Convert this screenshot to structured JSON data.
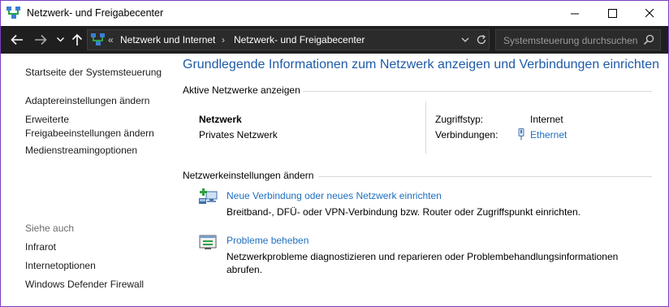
{
  "window": {
    "title": "Netzwerk- und Freigabecenter",
    "controls": {
      "minimize": "—",
      "maximize": "☐",
      "close": "✕"
    }
  },
  "navigation": {
    "back_icon": "arrow-left-icon",
    "forward_icon": "arrow-right-icon",
    "recent_icon": "chevron-down-icon",
    "up_icon": "arrow-up-icon",
    "breadcrumb_prefix": "«",
    "breadcrumbs": [
      "Netzwerk und Internet",
      "Netzwerk- und Freigabecenter"
    ],
    "breadcrumb_separator": "›",
    "search_placeholder": "Systemsteuerung durchsuchen"
  },
  "sidebar": {
    "home_link": "Startseite der Systemsteuerung",
    "links": [
      "Adaptereinstellungen ändern",
      "Erweiterte Freigabeeinstellungen ändern",
      "Medienstreamingoptionen"
    ],
    "see_also_heading": "Siehe auch",
    "see_also": [
      "Infrarot",
      "Internetoptionen",
      "Windows Defender Firewall"
    ]
  },
  "main": {
    "title": "Grundlegende Informationen zum Netzwerk anzeigen und Verbindungen einrichten",
    "active_networks": {
      "heading": "Aktive Netzwerke anzeigen",
      "network_name": "Netzwerk",
      "network_type": "Privates Netzwerk",
      "access_type_label": "Zugriffstyp:",
      "access_type_value": "Internet",
      "connections_label": "Verbindungen:",
      "connection_value": "Ethernet"
    },
    "settings": {
      "heading": "Netzwerkeinstellungen ändern",
      "tasks": [
        {
          "link": "Neue Verbindung oder neues Netzwerk einrichten",
          "description": "Breitband-, DFÜ- oder VPN-Verbindung bzw. Router oder Zugriffspunkt einrichten."
        },
        {
          "link": "Probleme beheben",
          "description": "Netzwerkprobleme diagnostizieren und reparieren oder Problembehandlungsinformationen abrufen."
        }
      ]
    }
  },
  "colors": {
    "accent_border": "#7a3fc0",
    "link_blue": "#1e6fc0",
    "title_blue": "#1e5aa8",
    "addressbar_bg": "#1f1f1f"
  }
}
